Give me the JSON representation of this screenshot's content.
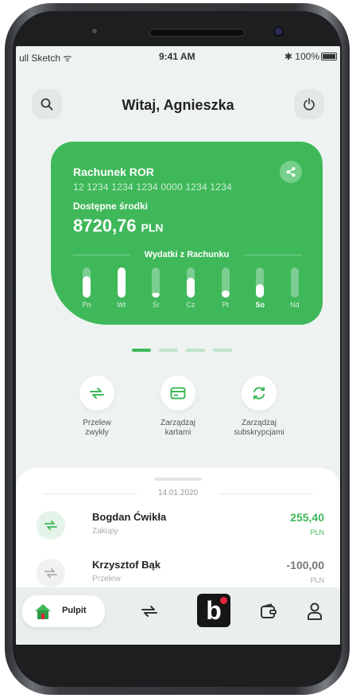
{
  "status_bar": {
    "carrier": "ull Sketch ᯤ",
    "time": "9:41 AM",
    "battery": "✱ 100%"
  },
  "header": {
    "greeting": "Witaj, Agnieszka",
    "search_icon": "search-icon",
    "power_icon": "power-icon"
  },
  "account_card": {
    "name": "Rachunek ROR",
    "number": "12 1234 1234 1234 0000 1234 1234",
    "available_label": "Dostępne środki",
    "balance": "8720,76",
    "currency": "PLN",
    "spending_title": "Wydatki z Rachunku",
    "days": [
      "Pn",
      "Wt",
      "Śr",
      "Cz",
      "Pt",
      "So",
      "Nd"
    ],
    "selected_day": "So",
    "spending_levels": [
      0.7,
      1.0,
      0.15,
      0.65,
      0.25,
      0.45,
      0.0
    ],
    "accent": "#3fb85a"
  },
  "carousel": {
    "pages": 4,
    "active": 0
  },
  "quick_actions": [
    {
      "label": "Przelew\nzwykły",
      "icon": "transfer-icon"
    },
    {
      "label": "Zarządzaj\nkartami",
      "icon": "card-icon"
    },
    {
      "label": "Zarządzaj\nsubskrypcjami",
      "icon": "refresh-icon"
    }
  ],
  "transactions": {
    "date": "14.01.2020",
    "items": [
      {
        "name": "Bogdan Ćwikła",
        "category": "Zakupy",
        "amount": "255,40",
        "currency": "PLN",
        "color": "#3fb85a"
      },
      {
        "name": "Krzysztof Bąk",
        "category": "Przelew",
        "amount": "-100,00",
        "currency": "PLN",
        "color": "#777777"
      }
    ]
  },
  "tabbar": {
    "home_label": "Pulpit",
    "brand": "b"
  }
}
